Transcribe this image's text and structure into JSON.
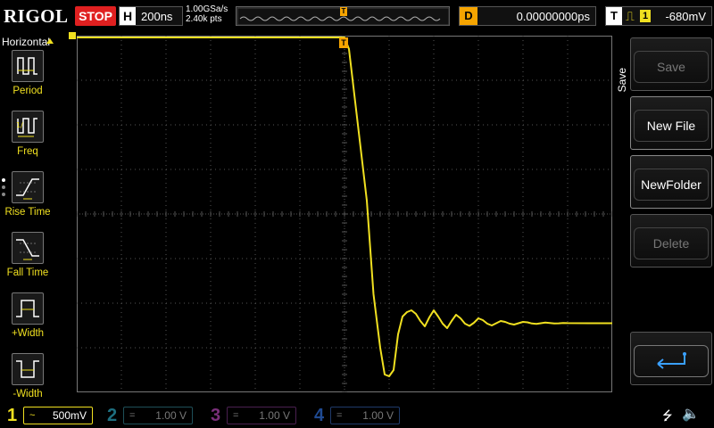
{
  "topbar": {
    "brand": "RIGOL",
    "run_status": "STOP",
    "timebase_tag": "H",
    "timebase": "200ns",
    "sample_rate": "1.00GSa/s",
    "memory_depth": "2.40k pts",
    "trigger_pos_tag": "T",
    "delay_tag": "D",
    "delay": "0.00000000ps",
    "trigger_tag": "T",
    "trigger_edge_icon": "rising-edge-icon",
    "trigger_source": "1",
    "trigger_level": "-680mV"
  },
  "horizontal_menu": {
    "title": "Horizontal",
    "items": [
      {
        "label": "Period",
        "icon": "period-icon"
      },
      {
        "label": "Freq",
        "icon": "frequency-icon"
      },
      {
        "label": "Rise Time",
        "icon": "rise-time-icon"
      },
      {
        "label": "Fall Time",
        "icon": "fall-time-icon"
      },
      {
        "label": "+Width",
        "icon": "positive-width-icon"
      },
      {
        "label": "-Width",
        "icon": "negative-width-icon"
      }
    ]
  },
  "save_menu": {
    "title": "Save",
    "buttons": [
      {
        "label": "Save",
        "enabled": false
      },
      {
        "label": "New File",
        "enabled": true
      },
      {
        "label": "NewFolder",
        "enabled": true
      },
      {
        "label": "Delete",
        "enabled": false
      },
      {
        "label": "",
        "icon": "enter-icon",
        "enabled": true
      }
    ]
  },
  "channels": [
    {
      "num": "1",
      "coupling": "~",
      "scale": "500mV",
      "color": "#f0e020",
      "active": true
    },
    {
      "num": "2",
      "coupling": "=",
      "scale": "1.00 V",
      "color": "#1e6f80",
      "active": false
    },
    {
      "num": "3",
      "coupling": "=",
      "scale": "1.00 V",
      "color": "#7a2f7a",
      "active": false
    },
    {
      "num": "4",
      "coupling": "=",
      "scale": "1.00 V",
      "color": "#1f4a92",
      "active": false
    }
  ],
  "status": {
    "usb_icon": "usb-icon",
    "sound_icon": "sound-muted-icon"
  },
  "colors": {
    "trace": "#f0e020",
    "trigger": "#f6a400",
    "grid": "#555555"
  },
  "chart_data": {
    "type": "line",
    "x_divisions": 12,
    "y_divisions": 8,
    "xlim": [
      -1200,
      1200
    ],
    "ylim": [
      -2000,
      2000
    ],
    "grid": true,
    "series": [
      {
        "color": "#f0e020",
        "x": [
          -1200,
          0,
          20,
          60,
          100,
          130,
          160,
          180,
          200,
          220,
          240,
          260,
          280,
          300,
          320,
          340,
          360,
          380,
          400,
          420,
          440,
          460,
          480,
          500,
          520,
          540,
          560,
          580,
          600,
          620,
          640,
          660,
          680,
          700,
          720,
          740,
          760,
          780,
          800,
          820,
          840,
          860,
          880,
          900,
          920,
          940,
          960,
          980,
          1000,
          1100,
          1200
        ],
        "y": [
          2000,
          2000,
          1850,
          1000,
          150,
          -900,
          -1500,
          -1800,
          -1820,
          -1750,
          -1350,
          -1150,
          -1100,
          -1080,
          -1120,
          -1200,
          -1260,
          -1160,
          -1080,
          -1150,
          -1230,
          -1280,
          -1200,
          -1130,
          -1170,
          -1230,
          -1255,
          -1220,
          -1170,
          -1190,
          -1230,
          -1250,
          -1225,
          -1200,
          -1210,
          -1230,
          -1240,
          -1225,
          -1210,
          -1215,
          -1228,
          -1232,
          -1225,
          -1218,
          -1222,
          -1228,
          -1226,
          -1222,
          -1224,
          -1225,
          -1225
        ]
      }
    ]
  }
}
